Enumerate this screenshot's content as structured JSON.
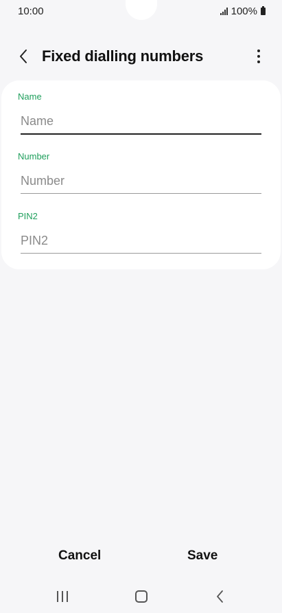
{
  "status": {
    "time": "10:00",
    "battery": "100%"
  },
  "header": {
    "title": "Fixed dialling numbers"
  },
  "form": {
    "fields": [
      {
        "label": "Name",
        "placeholder": "Name",
        "value": "",
        "focused": true
      },
      {
        "label": "Number",
        "placeholder": "Number",
        "value": ""
      },
      {
        "label": "PIN2",
        "placeholder": "PIN2",
        "value": ""
      }
    ]
  },
  "actions": {
    "cancel_label": "Cancel",
    "save_label": "Save"
  },
  "icons": {
    "back": "chevron-left-icon",
    "more": "more-vertical-icon",
    "nav_recents": "recents-icon",
    "nav_home": "home-icon",
    "nav_back": "back-icon"
  },
  "colors": {
    "accent": "#1f9f5c",
    "background": "#f6f6f8",
    "card": "#ffffff"
  }
}
